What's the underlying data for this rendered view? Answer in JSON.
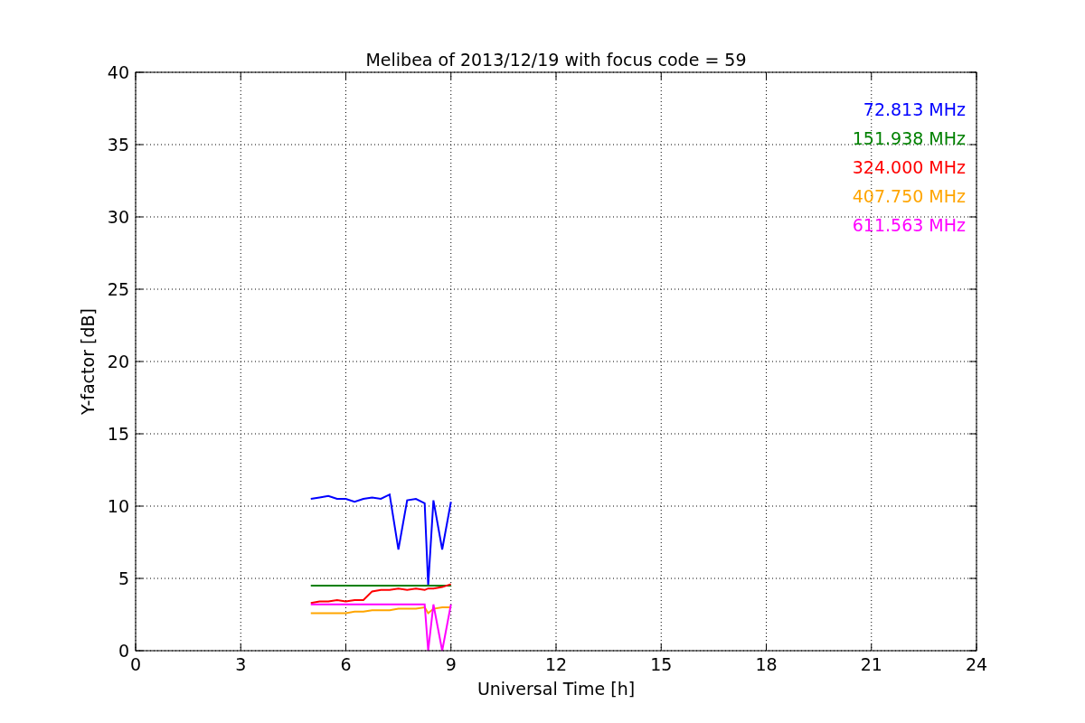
{
  "figure": {
    "chart_data": {
      "type": "line",
      "grid": true,
      "title": "Melibea of 2013/12/19 with focus code = 59",
      "xlabel": "Universal Time [h]",
      "ylabel": "Y-factor [dB]",
      "xlim": [
        0,
        24
      ],
      "ylim": [
        0,
        40
      ],
      "xticks": [
        0,
        3,
        6,
        9,
        12,
        15,
        18,
        21,
        24
      ],
      "yticks": [
        0,
        5,
        10,
        15,
        20,
        25,
        30,
        35,
        40
      ],
      "x": [
        5,
        5.25,
        5.5,
        5.75,
        6,
        6.25,
        6.5,
        6.75,
        7,
        7.25,
        7.5,
        7.75,
        8,
        8.25,
        8.35,
        8.5,
        8.75,
        9
      ],
      "series": [
        {
          "name": "72.813 MHz",
          "color": "#0000ff",
          "values": [
            10.5,
            10.6,
            10.7,
            10.5,
            10.5,
            10.3,
            10.5,
            10.6,
            10.5,
            10.8,
            7,
            10.4,
            10.5,
            10.2,
            4.5,
            10.4,
            7,
            10.3
          ]
        },
        {
          "name": "151.938 MHz",
          "color": "#008000",
          "values": [
            4.5,
            4.5,
            4.5,
            4.5,
            4.5,
            4.5,
            4.5,
            4.5,
            4.5,
            4.5,
            4.5,
            4.5,
            4.5,
            4.5,
            4.5,
            4.5,
            4.5,
            4.5
          ]
        },
        {
          "name": "324.000 MHz",
          "color": "#ff0000",
          "values": [
            3.3,
            3.4,
            3.4,
            3.5,
            3.4,
            3.5,
            3.5,
            4.1,
            4.2,
            4.2,
            4.3,
            4.2,
            4.3,
            4.2,
            4.3,
            4.3,
            4.4,
            4.6
          ]
        },
        {
          "name": "407.750 MHz",
          "color": "#ffa500",
          "values": [
            2.6,
            2.6,
            2.6,
            2.6,
            2.6,
            2.7,
            2.7,
            2.8,
            2.8,
            2.8,
            2.9,
            2.9,
            2.9,
            3,
            2.6,
            2.9,
            3,
            3
          ]
        },
        {
          "name": "611.563 MHz",
          "color": "#ff00ff",
          "values": [
            3.2,
            3.2,
            3.2,
            3.2,
            3.2,
            3.2,
            3.2,
            3.2,
            3.2,
            3.2,
            3.2,
            3.2,
            3.2,
            3.2,
            0,
            3.2,
            0,
            3.2
          ]
        }
      ]
    }
  }
}
